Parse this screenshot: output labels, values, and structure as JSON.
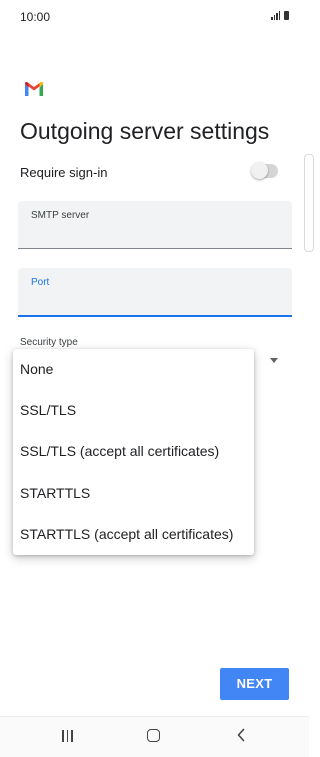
{
  "status_bar": {
    "time": "10:00",
    "signal_icon": "signal-icon",
    "battery_icon": "battery-icon"
  },
  "app": {
    "logo_icon": "gmail-logo-icon",
    "brand_colors": [
      "#4285f4",
      "#ea4335",
      "#fbbc04",
      "#34a853"
    ]
  },
  "page": {
    "title": "Outgoing server settings"
  },
  "require_signin": {
    "label": "Require sign-in",
    "enabled": false
  },
  "fields": {
    "smtp_server": {
      "label": "SMTP server",
      "value": ""
    },
    "port": {
      "label": "Port",
      "value": "",
      "focused": true
    }
  },
  "security": {
    "label": "Security type",
    "options": [
      "None",
      "SSL/TLS",
      "SSL/TLS (accept all certificates)",
      "STARTTLS",
      "STARTTLS (accept all certificates)"
    ]
  },
  "actions": {
    "next_label": "NEXT",
    "accent_color": "#4285f4"
  },
  "nav_bar": {
    "recents_icon": "recents-icon",
    "home_icon": "home-icon",
    "back_icon": "back-icon"
  }
}
